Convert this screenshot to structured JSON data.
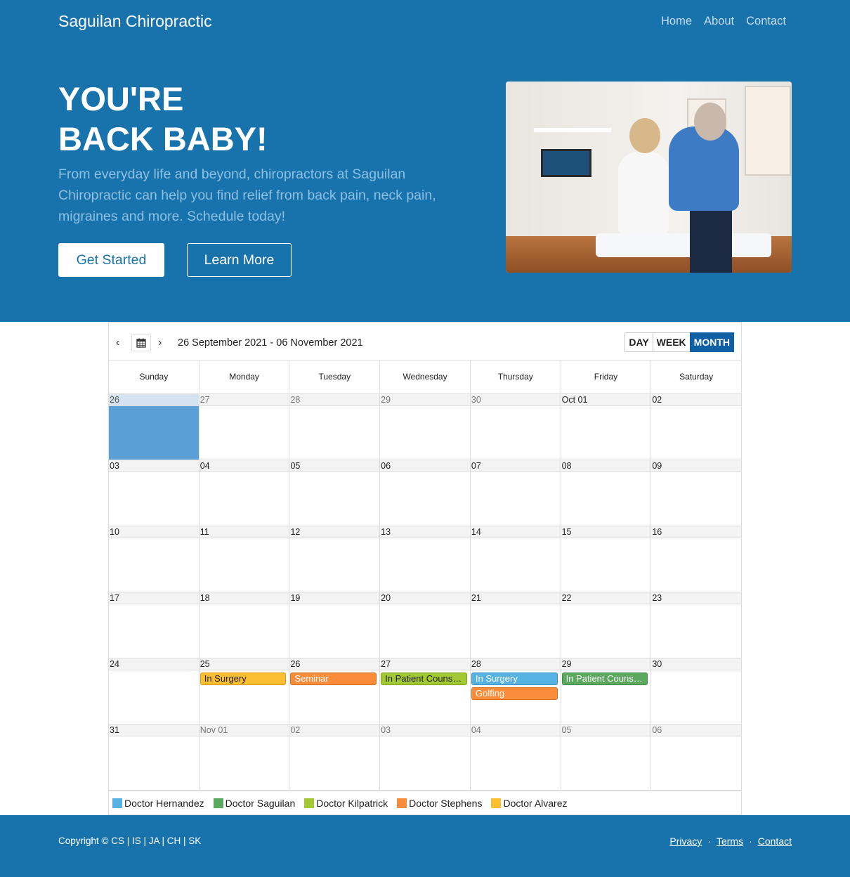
{
  "header": {
    "brand": "Saguilan Chiropractic",
    "nav": [
      "Home",
      "About",
      "Contact"
    ]
  },
  "hero": {
    "title_line1": "YOU'RE",
    "title_line2": "BACK BABY!",
    "text": "From everyday life and beyond, chiropractors at Saguilan Chiropractic can help you find relief from back pain, neck pain, migraines and more. Schedule today!",
    "primary_button": "Get Started",
    "secondary_button": "Learn More"
  },
  "calendar": {
    "prev": "‹",
    "next": "›",
    "range": "26 September 2021 - 06 November 2021",
    "views": [
      "DAY",
      "WEEK",
      "MONTH"
    ],
    "active_view": "MONTH",
    "weekdays": [
      "Sunday",
      "Monday",
      "Tuesday",
      "Wednesday",
      "Thursday",
      "Friday",
      "Saturday"
    ],
    "weeks": [
      [
        {
          "date": "26",
          "other": false,
          "today": true
        },
        {
          "date": "27",
          "other": true
        },
        {
          "date": "28",
          "other": true
        },
        {
          "date": "29",
          "other": true
        },
        {
          "date": "30",
          "other": true
        },
        {
          "date": "Oct 01"
        },
        {
          "date": "02"
        }
      ],
      [
        {
          "date": "03"
        },
        {
          "date": "04"
        },
        {
          "date": "05"
        },
        {
          "date": "06"
        },
        {
          "date": "07"
        },
        {
          "date": "08"
        },
        {
          "date": "09"
        }
      ],
      [
        {
          "date": "10"
        },
        {
          "date": "11"
        },
        {
          "date": "12"
        },
        {
          "date": "13"
        },
        {
          "date": "14"
        },
        {
          "date": "15"
        },
        {
          "date": "16"
        }
      ],
      [
        {
          "date": "17"
        },
        {
          "date": "18"
        },
        {
          "date": "19"
        },
        {
          "date": "20"
        },
        {
          "date": "21"
        },
        {
          "date": "22"
        },
        {
          "date": "23"
        }
      ],
      [
        {
          "date": "24"
        },
        {
          "date": "25",
          "events": [
            {
              "title": "In Surgery",
              "color": "yellow"
            }
          ]
        },
        {
          "date": "26",
          "events": [
            {
              "title": "Seminar",
              "color": "orange"
            }
          ]
        },
        {
          "date": "27",
          "events": [
            {
              "title": "In Patient Counseling",
              "color": "lime"
            }
          ]
        },
        {
          "date": "28",
          "events": [
            {
              "title": "In Surgery",
              "color": "blue"
            },
            {
              "title": "Golfing",
              "color": "orange"
            }
          ]
        },
        {
          "date": "29",
          "events": [
            {
              "title": "In Patient Counseling",
              "color": "green"
            }
          ]
        },
        {
          "date": "30"
        }
      ],
      [
        {
          "date": "31"
        },
        {
          "date": "Nov 01",
          "other": true
        },
        {
          "date": "02",
          "other": true
        },
        {
          "date": "03",
          "other": true
        },
        {
          "date": "04",
          "other": true
        },
        {
          "date": "05",
          "other": true
        },
        {
          "date": "06",
          "other": true
        }
      ]
    ],
    "legend": [
      {
        "name": "Doctor Hernandez",
        "color": "#56b2e3"
      },
      {
        "name": "Doctor Saguilan",
        "color": "#5aa95f"
      },
      {
        "name": "Doctor Kilpatrick",
        "color": "#a2c933"
      },
      {
        "name": "Doctor Stephens",
        "color": "#fa8d3b"
      },
      {
        "name": "Doctor Alvarez",
        "color": "#fbbe33"
      }
    ]
  },
  "footer": {
    "copyright": "Copyright © CS | IS | JA | CH | SK",
    "links": [
      "Privacy",
      "Terms",
      "Contact"
    ],
    "separator": "·"
  },
  "colors": {
    "brand_blue": "#1872ab",
    "active_view": "#0e5fa3",
    "today_fill": "#5a9fd6"
  }
}
